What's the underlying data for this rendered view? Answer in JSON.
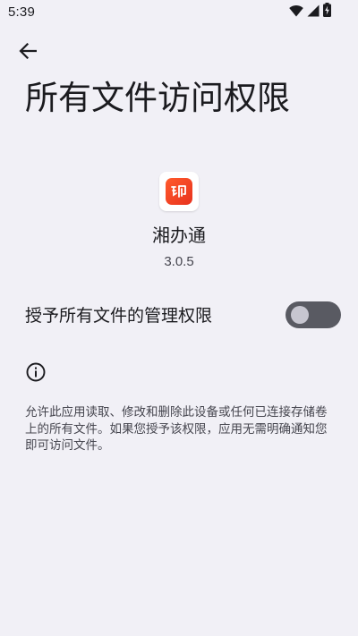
{
  "status_bar": {
    "time": "5:39",
    "icons": [
      "wifi-icon",
      "cellular-signal-icon",
      "battery-charging-icon"
    ]
  },
  "header": {
    "back_icon": "arrow-left-icon",
    "title": "所有文件访问权限"
  },
  "app": {
    "icon": "app-icon",
    "name": "湘办通",
    "version": "3.0.5",
    "brand_color": "#ff4b24"
  },
  "permission": {
    "label": "授予所有文件的管理权限",
    "enabled": false
  },
  "info": {
    "icon": "info-icon",
    "description": "允许此应用读取、修改和删除此设备或任何已连接存储卷上的所有文件。如果您授予该权限，应用无需明确通知您即可访问文件。"
  },
  "colors": {
    "background": "#f1f0f6",
    "text_primary": "#1b1b1f",
    "text_secondary": "#46464f",
    "switch_track_off": "#595a62",
    "switch_knob_off": "#c7c6d0"
  }
}
